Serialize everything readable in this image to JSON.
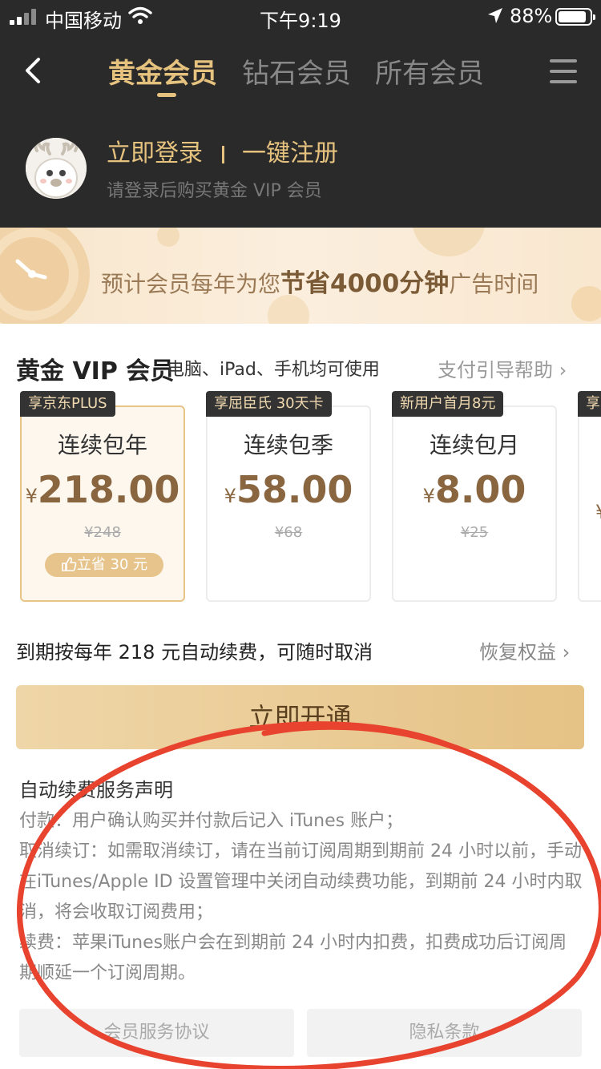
{
  "status": {
    "carrier": "中国移动",
    "time": "下午9:19",
    "battery": "88%"
  },
  "header": {
    "tabs": [
      {
        "label": "黄金会员",
        "active": true
      },
      {
        "label": "钻石会员",
        "active": false
      },
      {
        "label": "所有会员",
        "active": false
      }
    ]
  },
  "user": {
    "login": "立即登录",
    "register": "一键注册",
    "hint": "请登录后购买黄金 VIP 会员"
  },
  "banner": {
    "prefix": "预计会员每年为您",
    "highlight": "节省4000分钟",
    "suffix": "广告时间"
  },
  "section": {
    "title": "黄金 VIP 会员",
    "subtitle": "电脑、iPad、手机均可使用",
    "help": "支付引导帮助 ›"
  },
  "plans": [
    {
      "badge": "享京东PLUS",
      "name": "连续包年",
      "currency": "¥",
      "price": "218.00",
      "original": "¥248",
      "save": "立省 30 元",
      "selected": true
    },
    {
      "badge": "享屈臣氏 30天卡",
      "name": "连续包季",
      "currency": "¥",
      "price": "58.00",
      "original": "¥68",
      "selected": false
    },
    {
      "badge": "新用户首月8元",
      "name": "连续包月",
      "currency": "¥",
      "price": "8.00",
      "original": "¥25",
      "selected": false
    },
    {
      "badge": "享",
      "currency": "¥"
    }
  ],
  "renew": {
    "note": "到期按每年 218 元自动续费，可随时取消",
    "restore": "恢复权益 ›"
  },
  "cta": "立即开通",
  "declaration": {
    "title": "自动续费服务声明",
    "lines": [
      "付款：用户确认购买并付款后记入 iTunes 账户；",
      "取消续订：如需取消续订，请在当前订阅周期到期前 24 小时以前，手动在iTunes/Apple ID 设置管理中关闭自动续费功能，到期前 24 小时内取消，将会收取订阅费用；",
      "续费：苹果iTunes账户会在到期前 24 小时内扣费，扣费成功后订阅周期顺延一个订阅周期。"
    ]
  },
  "footer": {
    "agreement": "会员服务协议",
    "privacy": "隐私条款"
  },
  "colors": {
    "gold": "#e6c27f",
    "dark": "#2a2a2a",
    "annotation": "#e8432e"
  }
}
